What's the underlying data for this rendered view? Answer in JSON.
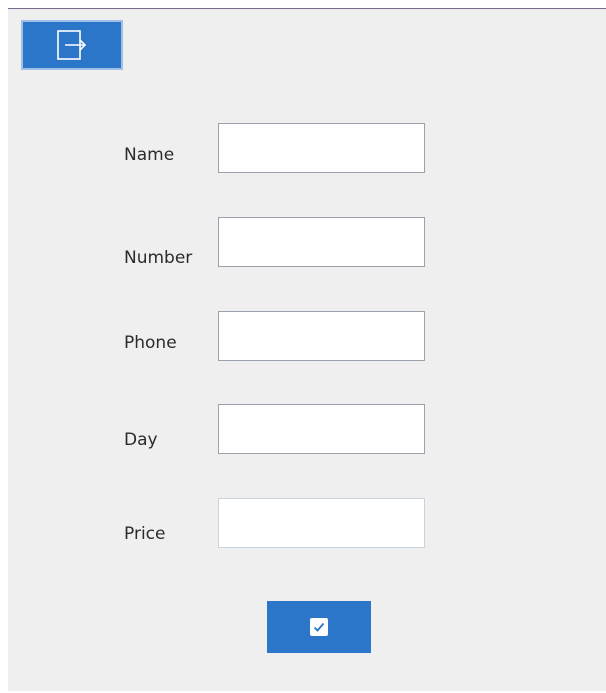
{
  "toolbar": {
    "exit_icon": "sign-out-icon"
  },
  "form": {
    "fields": [
      {
        "label": "Name",
        "value": "",
        "placeholder": ""
      },
      {
        "label": "Number",
        "value": "",
        "placeholder": ""
      },
      {
        "label": "Phone",
        "value": "",
        "placeholder": ""
      },
      {
        "label": "Day",
        "value": "",
        "placeholder": ""
      },
      {
        "label": "Price",
        "value": "",
        "placeholder": ""
      }
    ],
    "submit_icon": "checkbox-check-icon"
  },
  "colors": {
    "accent": "#2b76c8",
    "background": "#efefef",
    "input_border": "#9aa3ad"
  }
}
